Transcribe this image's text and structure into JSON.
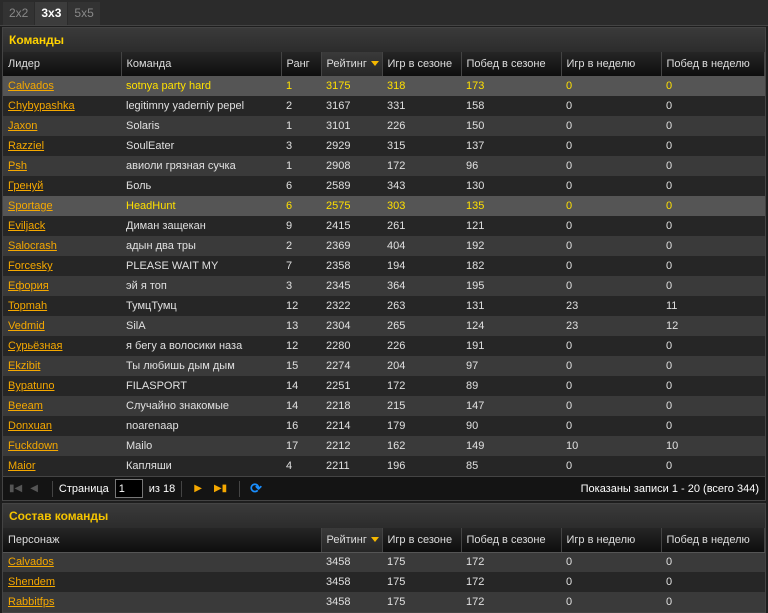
{
  "tabs": [
    {
      "label": "2x2",
      "active": false
    },
    {
      "label": "3x3",
      "active": true
    },
    {
      "label": "5x5",
      "active": false
    }
  ],
  "teams": {
    "title": "Команды",
    "columns": [
      "Лидер",
      "Команда",
      "Ранг",
      "Рейтинг",
      "Игр в сезоне",
      "Побед в сезоне",
      "Игр в неделю",
      "Побед в неделю"
    ],
    "sorted_column": "Рейтинг",
    "highlighted_rows": [
      0,
      6
    ],
    "rows": [
      [
        "Calvados",
        "sotnya party hard",
        "1",
        "3175",
        "318",
        "173",
        "0",
        "0"
      ],
      [
        "Chybypashka",
        "legitimny yaderniy pepel",
        "2",
        "3167",
        "331",
        "158",
        "0",
        "0"
      ],
      [
        "Jaxon",
        "Solaris",
        "1",
        "3101",
        "226",
        "150",
        "0",
        "0"
      ],
      [
        "Razziel",
        "SoulEater",
        "3",
        "2929",
        "315",
        "137",
        "0",
        "0"
      ],
      [
        "Psh",
        "авиоли грязная сучка",
        "1",
        "2908",
        "172",
        "96",
        "0",
        "0"
      ],
      [
        "Гренуй",
        "Боль",
        "6",
        "2589",
        "343",
        "130",
        "0",
        "0"
      ],
      [
        "Sportage",
        "HeadHunt",
        "6",
        "2575",
        "303",
        "135",
        "0",
        "0"
      ],
      [
        "Eviljack",
        "Диман защекан",
        "9",
        "2415",
        "261",
        "121",
        "0",
        "0"
      ],
      [
        "Salocrash",
        "адын два тры",
        "2",
        "2369",
        "404",
        "192",
        "0",
        "0"
      ],
      [
        "Forcesky",
        "PLEASE WAIT MY",
        "7",
        "2358",
        "194",
        "182",
        "0",
        "0"
      ],
      [
        "Ефория",
        "эй я топ",
        "3",
        "2345",
        "364",
        "195",
        "0",
        "0"
      ],
      [
        "Topmah",
        "ТумцТумц",
        "12",
        "2322",
        "263",
        "131",
        "23",
        "11"
      ],
      [
        "Vedmid",
        "SilA",
        "13",
        "2304",
        "265",
        "124",
        "23",
        "12"
      ],
      [
        "Сурьёзная",
        "я бегу а волосики наза",
        "12",
        "2280",
        "226",
        "191",
        "0",
        "0"
      ],
      [
        "Ekzibit",
        "Ты любишь дым дым",
        "15",
        "2274",
        "204",
        "97",
        "0",
        "0"
      ],
      [
        "Bypatuno",
        "FILASPORT",
        "14",
        "2251",
        "172",
        "89",
        "0",
        "0"
      ],
      [
        "Beeam",
        "Случайно знакомые",
        "14",
        "2218",
        "215",
        "147",
        "0",
        "0"
      ],
      [
        "Donxuan",
        "noarenaap",
        "16",
        "2214",
        "179",
        "90",
        "0",
        "0"
      ],
      [
        "Fuckdown",
        "Mailo",
        "17",
        "2212",
        "162",
        "149",
        "10",
        "10"
      ],
      [
        "Maior",
        "Капляши",
        "4",
        "2211",
        "196",
        "85",
        "0",
        "0"
      ]
    ]
  },
  "pager": {
    "page_label": "Страница",
    "page_value": "1",
    "of_label": "из 18",
    "info": "Показаны записи 1 - 20 (всего 344)"
  },
  "roster": {
    "title": "Состав команды",
    "columns": [
      "Персонаж",
      "Рейтинг",
      "Игр в сезоне",
      "Побед в сезоне",
      "Игр в неделю",
      "Побед в неделю"
    ],
    "sorted_column": "Рейтинг",
    "rows": [
      [
        "Calvados",
        "3458",
        "175",
        "172",
        "0",
        "0"
      ],
      [
        "Shendem",
        "3458",
        "175",
        "172",
        "0",
        "0"
      ],
      [
        "Rabbitfps",
        "3458",
        "175",
        "172",
        "0",
        "0"
      ]
    ]
  },
  "colors": {
    "accent": "#ffd200",
    "link": "#f5a800",
    "refresh": "#1a8fff"
  }
}
